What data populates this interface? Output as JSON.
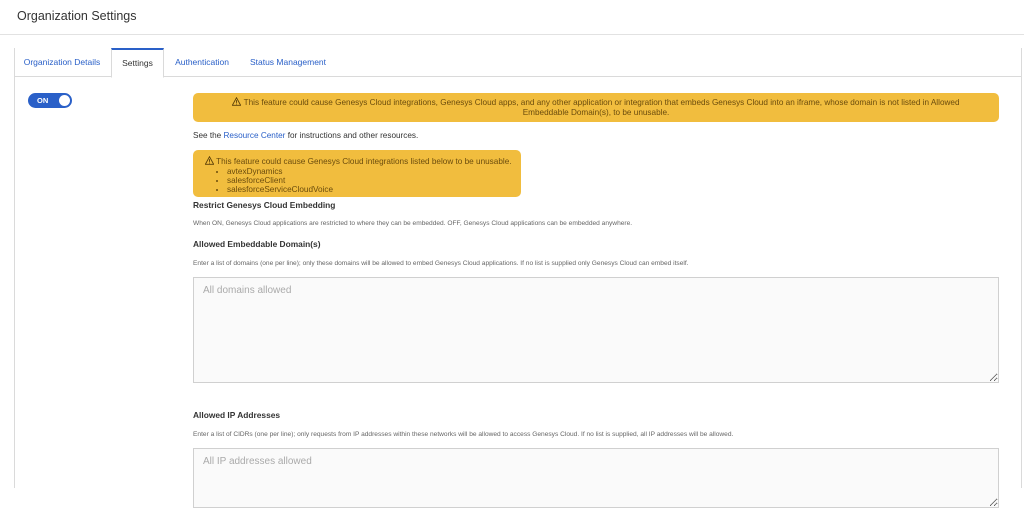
{
  "header": {
    "title": "Organization Settings"
  },
  "tabs": [
    {
      "label": "Organization Details"
    },
    {
      "label": "Settings"
    },
    {
      "label": "Authentication"
    },
    {
      "label": "Status Management"
    }
  ],
  "toggle": {
    "label": "ON",
    "state": "on",
    "color": "#2a60c8"
  },
  "warning_top": {
    "line1": "This feature could cause Genesys Cloud integrations, Genesys Cloud apps, and any other application or integration that embeds Genesys Cloud into an iframe, whose domain is not listed in Allowed",
    "line2": "Embeddable Domain(s), to be unusable."
  },
  "resource": {
    "prefix": "See the",
    "link": "Resource Center",
    "suffix": "for instructions and other resources."
  },
  "warning_integrations": {
    "message": "This feature could cause Genesys Cloud integrations listed below to be unusable.",
    "items": [
      "avtexDynamics",
      "salesforceClient",
      "salesforceServiceCloudVoice"
    ]
  },
  "restrict": {
    "heading": "Restrict Genesys Cloud Embedding",
    "description": "When ON, Genesys Cloud applications are restricted to where they can be embedded. OFF, Genesys Cloud applications can be embedded anywhere."
  },
  "domains": {
    "heading": "Allowed Embeddable Domain(s)",
    "description": "Enter a list of domains (one per line); only these domains will be allowed to embed Genesys Cloud applications. If no list is supplied only Genesys Cloud can embed itself.",
    "placeholder": "All domains allowed",
    "value": ""
  },
  "ip": {
    "heading": "Allowed IP Addresses",
    "description": "Enter a list of CIDRs (one per line); only requests from IP addresses within these networks will be allowed to access Genesys Cloud. If no list is supplied, all IP addresses will be allowed.",
    "placeholder": "All IP addresses allowed",
    "value": ""
  },
  "colors": {
    "accent": "#2a60c8",
    "warning_bg": "#f1bd3e",
    "warning_text": "#6b4c0d"
  },
  "icons": {
    "warning": "warning-triangle-icon"
  }
}
